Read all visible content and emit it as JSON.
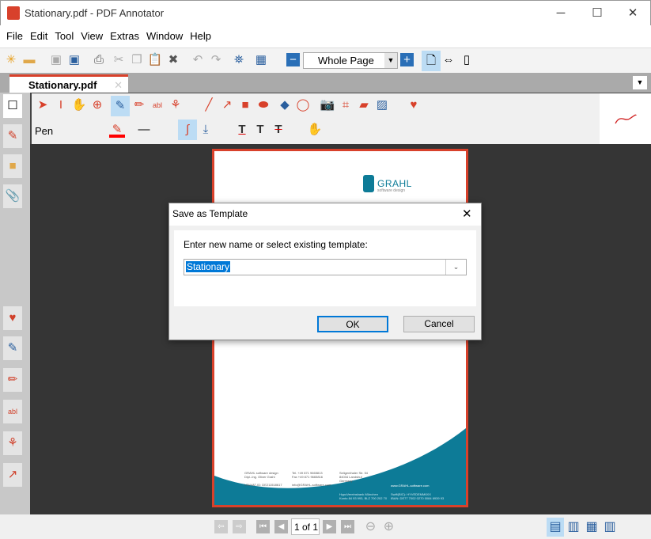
{
  "window": {
    "title": "Stationary.pdf - PDF Annotator",
    "minimize": "─",
    "maximize": "☐",
    "close": "✕"
  },
  "menu": [
    "File",
    "Edit",
    "Tool",
    "View",
    "Extras",
    "Window",
    "Help"
  ],
  "toolbar": {
    "zoom_value": "Whole Page"
  },
  "tab": {
    "label": "Stationary.pdf",
    "close": "✕"
  },
  "tool": {
    "name": "Pen"
  },
  "page": {
    "logo": "GRAHL",
    "logo_sub": "software design",
    "footer": {
      "col1": [
        "GRAHL software design",
        "Dipl.-Ing. Oliver Grahl",
        "",
        "USt/VAT-ID: DE211518617"
      ],
      "col2": [
        "Tel.  +49 871 9665813",
        "Fax  +49 871 9665816",
        "",
        "info@GRAHL-software.com"
      ],
      "col3": [
        "Seligenthaler Str. 54",
        "84034 Landshut",
        "Germany"
      ],
      "web": "www.GRAHL-software.com",
      "bank1": [
        "HypoVereinsbank München",
        "Konto 84 93 993, BLZ 700 202 70"
      ],
      "bank2": [
        "Swift(BIC): HYVEDEMM6XX",
        "IBAN: DE77 7002 0270 0084 6939 93"
      ]
    }
  },
  "dialog": {
    "title": "Save as Template",
    "prompt": "Enter new name or select existing template:",
    "value": "Stationary",
    "ok": "OK",
    "cancel": "Cancel",
    "close": "✕"
  },
  "status": {
    "page_indicator": "1 of 1"
  },
  "colors": {
    "accent": "#d8412b",
    "page_blue": "#0d7b97",
    "selected": "#bcdcf4"
  }
}
